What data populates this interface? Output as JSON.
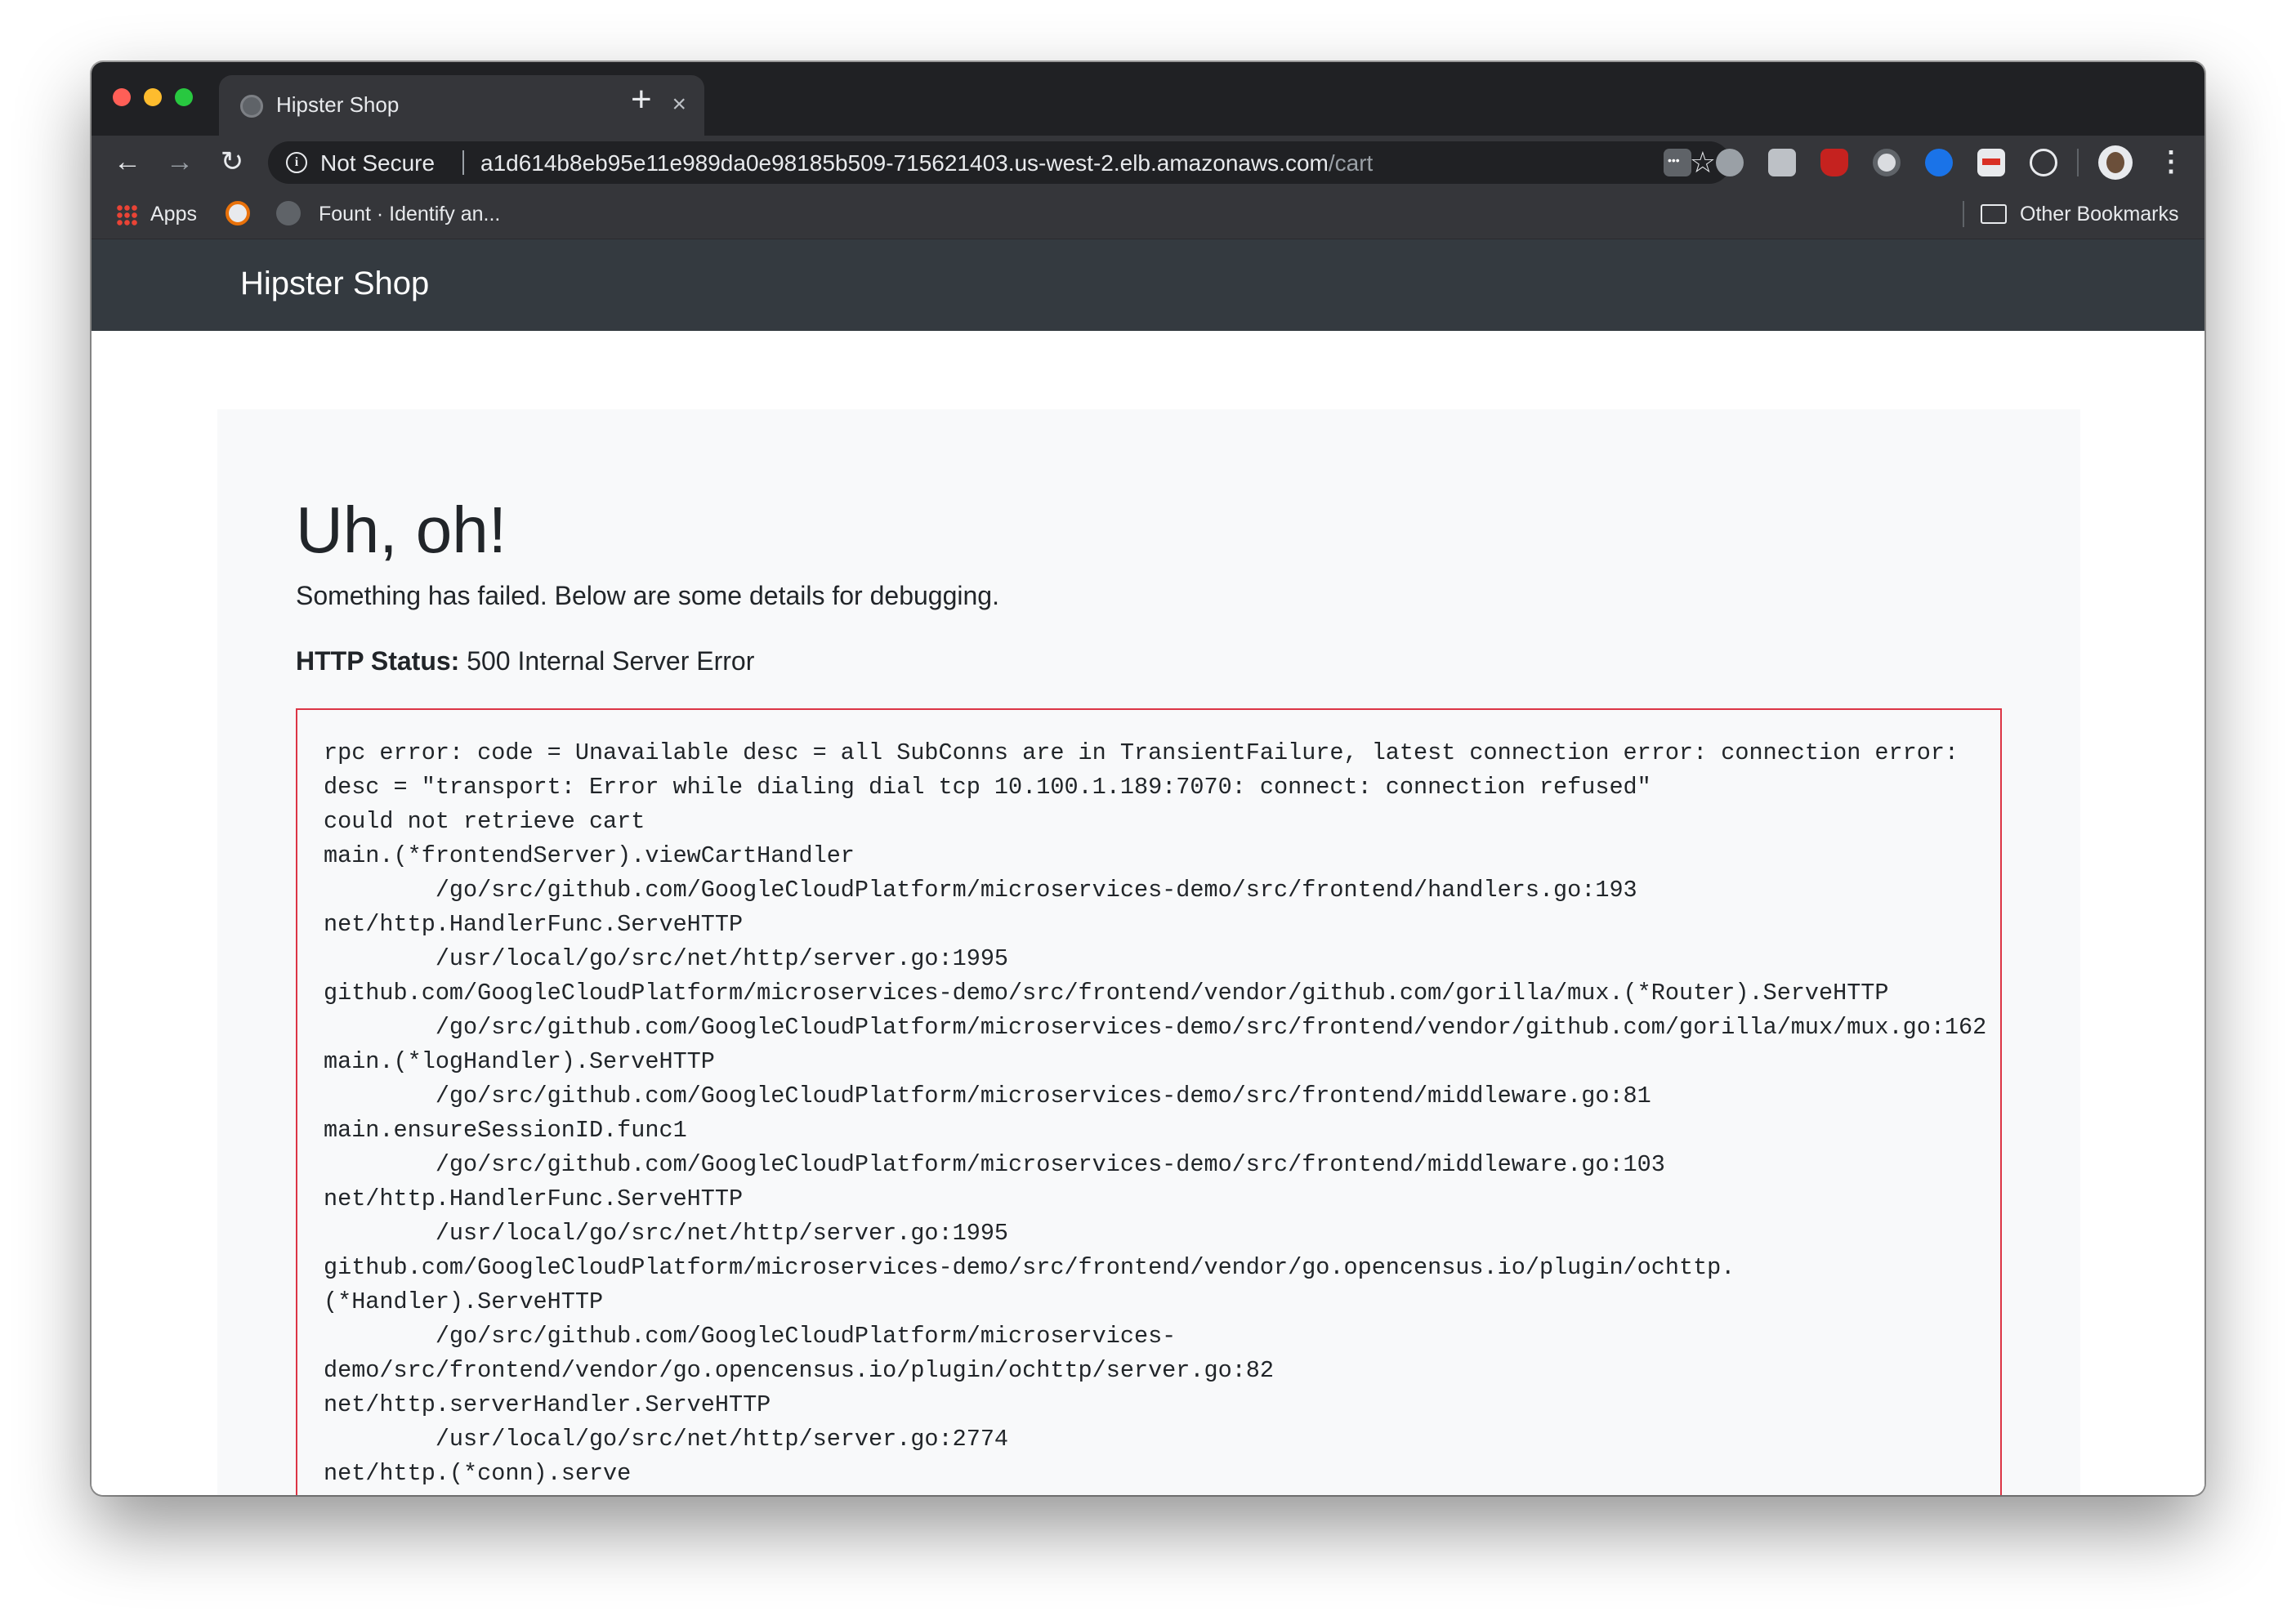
{
  "browser": {
    "tab_title": "Hipster Shop",
    "tab_close": "×",
    "new_tab": "+",
    "nav": {
      "back": "←",
      "forward": "→",
      "reload": "↻"
    },
    "security_label": "Not Secure",
    "url_host": "a1d614b8eb95e11e989da0e98185b509-715621403.us-west-2.elb.amazonaws.com",
    "url_path": "/cart",
    "star": "☆",
    "menu": "⋮",
    "info_glyph": "i"
  },
  "bookmarks": {
    "apps": "Apps",
    "fount": "Fount · Identify an...",
    "other": "Other Bookmarks"
  },
  "site": {
    "brand": "Hipster Shop"
  },
  "error": {
    "title": "Uh, oh!",
    "description": "Something has failed. Below are some details for debugging.",
    "status_label": "HTTP Status:",
    "status_value": "500 Internal Server Error",
    "trace": "rpc error: code = Unavailable desc = all SubConns are in TransientFailure, latest connection error: connection error:\ndesc = \"transport: Error while dialing dial tcp 10.100.1.189:7070: connect: connection refused\"\ncould not retrieve cart\nmain.(*frontendServer).viewCartHandler\n        /go/src/github.com/GoogleCloudPlatform/microservices-demo/src/frontend/handlers.go:193\nnet/http.HandlerFunc.ServeHTTP\n        /usr/local/go/src/net/http/server.go:1995\ngithub.com/GoogleCloudPlatform/microservices-demo/src/frontend/vendor/github.com/gorilla/mux.(*Router).ServeHTTP\n        /go/src/github.com/GoogleCloudPlatform/microservices-demo/src/frontend/vendor/github.com/gorilla/mux/mux.go:162\nmain.(*logHandler).ServeHTTP\n        /go/src/github.com/GoogleCloudPlatform/microservices-demo/src/frontend/middleware.go:81\nmain.ensureSessionID.func1\n        /go/src/github.com/GoogleCloudPlatform/microservices-demo/src/frontend/middleware.go:103\nnet/http.HandlerFunc.ServeHTTP\n        /usr/local/go/src/net/http/server.go:1995\ngithub.com/GoogleCloudPlatform/microservices-demo/src/frontend/vendor/go.opencensus.io/plugin/ochttp.\n(*Handler).ServeHTTP\n        /go/src/github.com/GoogleCloudPlatform/microservices-\ndemo/src/frontend/vendor/go.opencensus.io/plugin/ochttp/server.go:82\nnet/http.serverHandler.ServeHTTP\n        /usr/local/go/src/net/http/server.go:2774\nnet/http.(*conn).serve"
  },
  "colors": {
    "tabstrip": "#202124",
    "toolbar": "#35363a",
    "site_header": "#343a40",
    "card_bg": "#f8f9fa",
    "trace_border": "#dc3545"
  }
}
